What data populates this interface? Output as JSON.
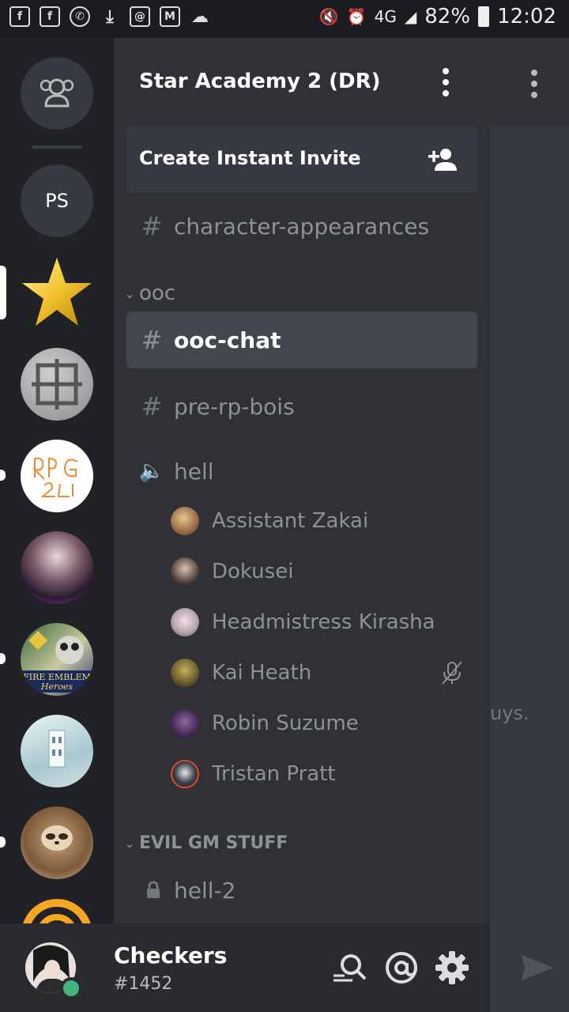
{
  "status_bar": {
    "battery": "82%",
    "time": "12:02",
    "network": "4G",
    "left_icons": [
      "facebook-icon",
      "facebook-icon",
      "whatsapp-icon",
      "download-icon",
      "mail-icon",
      "gmail-icon",
      "game-icon"
    ]
  },
  "server": {
    "name": "Star Academy 2 (DR)",
    "invite_label": "Create Instant Invite"
  },
  "guilds": [
    {
      "name": "friends",
      "icon": "friends-icon"
    },
    {
      "name": "PS",
      "label": "PS"
    },
    {
      "name": "star",
      "selected": true
    },
    {
      "name": "stone-emblem"
    },
    {
      "name": "rpg",
      "unread": true
    },
    {
      "name": "anime-girl"
    },
    {
      "name": "fire-emblem-heroes",
      "unread": true
    },
    {
      "name": "building"
    },
    {
      "name": "sloth",
      "unread": true
    },
    {
      "name": "orange-spiral"
    }
  ],
  "channels": {
    "top_channel": "character-appearances",
    "categories": [
      {
        "name": "ooc",
        "channels": [
          "ooc-chat",
          "pre-rp-bois"
        ],
        "active": "ooc-chat"
      },
      {
        "name": "EVIL GM STUFF",
        "channels": [
          "hell-2"
        ]
      }
    ],
    "voice_channel": "hell",
    "voice_members": [
      {
        "name": "Assistant Zakai",
        "color": "#c7a26a"
      },
      {
        "name": "Dokusei",
        "color": "#5a4a44"
      },
      {
        "name": "Headmistress Kirasha",
        "color": "#d8cfcf"
      },
      {
        "name": "Kai Heath",
        "color": "#7a6a2c",
        "muted": true
      },
      {
        "name": "Robin Suzume",
        "color": "#5b3a6d"
      },
      {
        "name": "Tristan Pratt",
        "color": "#2a2e3a"
      }
    ]
  },
  "user": {
    "name": "Checkers",
    "discriminator": "#1452",
    "status": "online"
  },
  "background_hint": "uys.",
  "colors": {
    "background": "#202225",
    "channel_panel": "#2f3136",
    "active_channel": "#42464d",
    "online": "#43b581"
  }
}
